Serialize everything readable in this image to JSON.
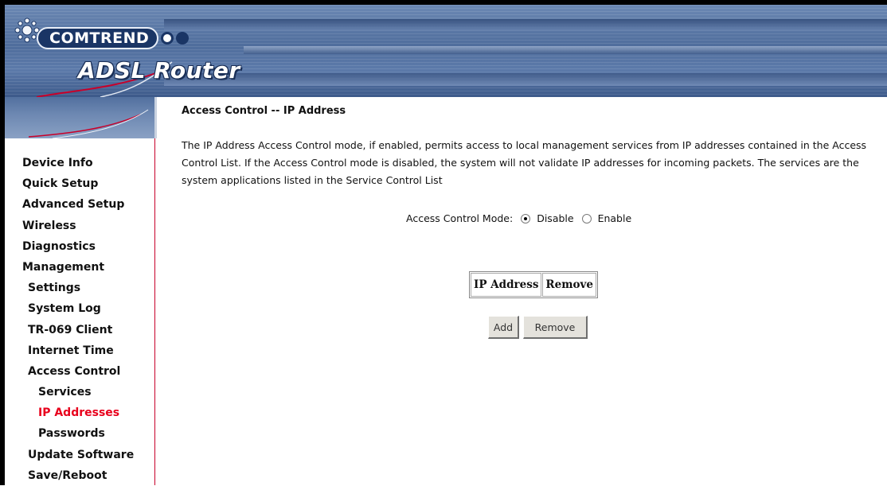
{
  "header": {
    "brand": "COMTREND",
    "product_title": "ADSL Router"
  },
  "sidebar": {
    "items": [
      {
        "label": "Device Info",
        "level": 0,
        "active": false
      },
      {
        "label": "Quick Setup",
        "level": 0,
        "active": false
      },
      {
        "label": "Advanced Setup",
        "level": 0,
        "active": false
      },
      {
        "label": "Wireless",
        "level": 0,
        "active": false
      },
      {
        "label": "Diagnostics",
        "level": 0,
        "active": false
      },
      {
        "label": "Management",
        "level": 0,
        "active": false
      },
      {
        "label": "Settings",
        "level": 1,
        "active": false
      },
      {
        "label": "System Log",
        "level": 1,
        "active": false
      },
      {
        "label": "TR-069 Client",
        "level": 1,
        "active": false
      },
      {
        "label": "Internet Time",
        "level": 1,
        "active": false
      },
      {
        "label": "Access Control",
        "level": 1,
        "active": false
      },
      {
        "label": "Services",
        "level": 2,
        "active": false
      },
      {
        "label": "IP Addresses",
        "level": 2,
        "active": true
      },
      {
        "label": "Passwords",
        "level": 2,
        "active": false
      },
      {
        "label": "Update Software",
        "level": 1,
        "active": false
      },
      {
        "label": "Save/Reboot",
        "level": 1,
        "active": false
      }
    ],
    "active_color": "#e8001c"
  },
  "main": {
    "title": "Access Control -- IP Address",
    "description": "The IP Address Access Control mode, if enabled, permits access to local management services from IP addresses contained in the Access Control List. If the Access Control mode is disabled, the system will not validate IP addresses for incoming packets. The services are the system applications listed in the Service Control List",
    "mode_label": "Access Control Mode:",
    "mode_options": [
      {
        "label": "Disable",
        "checked": true
      },
      {
        "label": "Enable",
        "checked": false
      }
    ],
    "table_headers": [
      "IP Address",
      "Remove"
    ],
    "buttons": {
      "add": "Add",
      "remove": "Remove"
    }
  }
}
